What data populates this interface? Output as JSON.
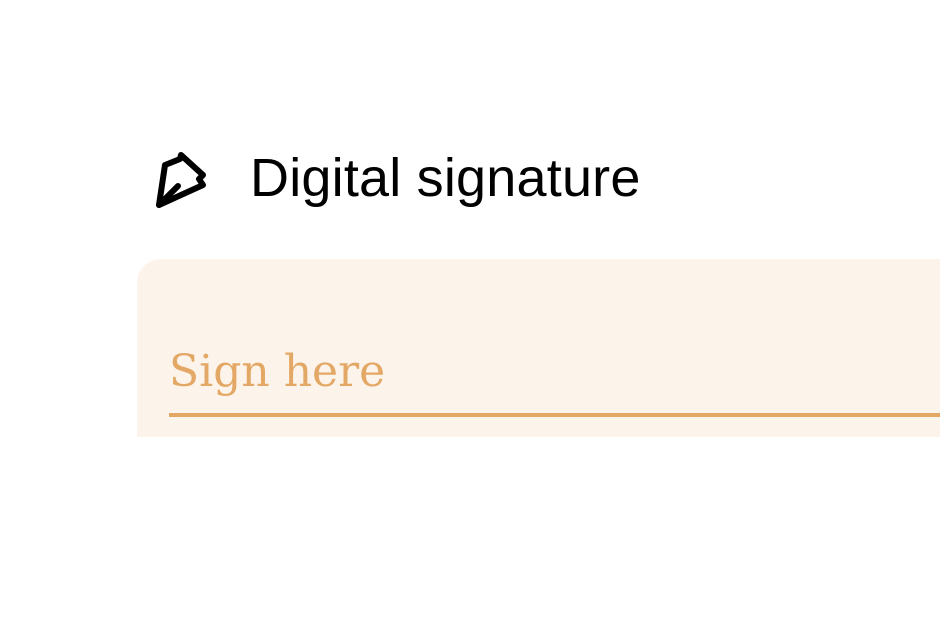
{
  "header": {
    "icon": "pen-nib-icon",
    "title": "Digital signature"
  },
  "signature": {
    "placeholder": "Sign here",
    "value": ""
  },
  "colors": {
    "panel_bg": "#fcf4ea",
    "accent": "#e3a866",
    "text": "#000000"
  }
}
